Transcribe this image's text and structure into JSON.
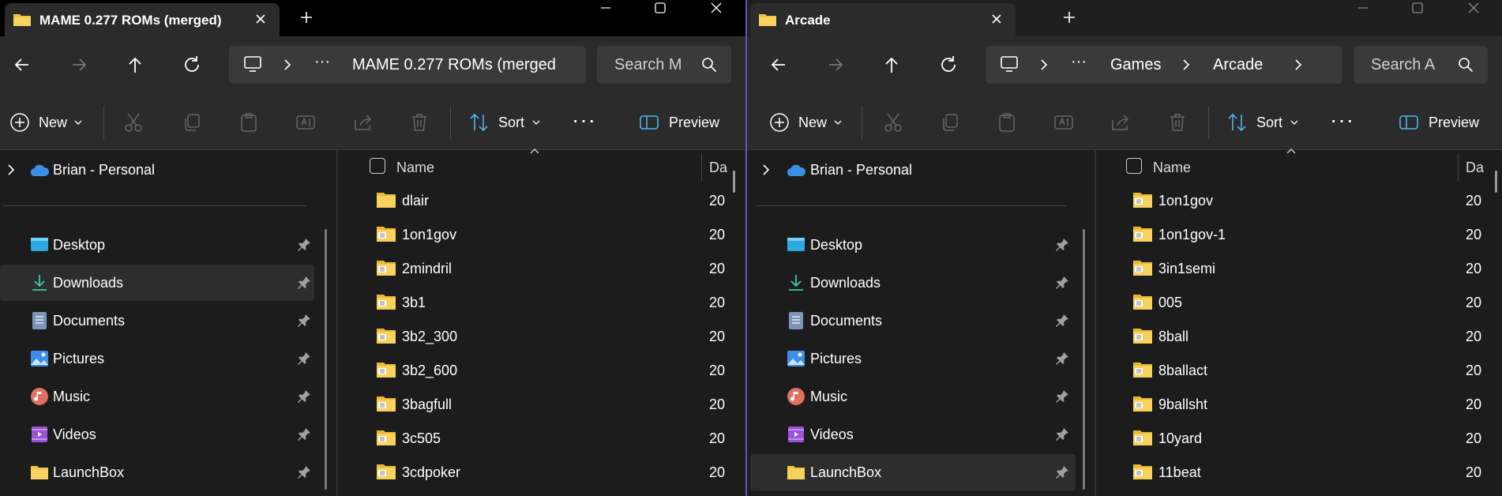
{
  "left": {
    "tab_title": "MAME 0.277 ROMs (merged)",
    "breadcrumb": [
      "MAME 0.277 ROMs (merged"
    ],
    "search_placeholder": "Search M",
    "toolbar": {
      "new": "New",
      "sort": "Sort",
      "preview": "Preview"
    },
    "nav": {
      "onedrive": "Brian - Personal",
      "items": [
        "Desktop",
        "Downloads",
        "Documents",
        "Pictures",
        "Music",
        "Videos",
        "LaunchBox"
      ],
      "selected": "Downloads"
    },
    "columns": {
      "name": "Name",
      "date": "Da"
    },
    "files": [
      {
        "name": "dlair",
        "date": "20"
      },
      {
        "name": "1on1gov",
        "date": "20"
      },
      {
        "name": "2mindril",
        "date": "20"
      },
      {
        "name": "3b1",
        "date": "20"
      },
      {
        "name": "3b2_300",
        "date": "20"
      },
      {
        "name": "3b2_600",
        "date": "20"
      },
      {
        "name": "3bagfull",
        "date": "20"
      },
      {
        "name": "3c505",
        "date": "20"
      },
      {
        "name": "3cdpoker",
        "date": "20"
      }
    ]
  },
  "right": {
    "tab_title": "Arcade",
    "breadcrumb": [
      "Games",
      "Arcade"
    ],
    "search_placeholder": "Search A",
    "toolbar": {
      "new": "New",
      "sort": "Sort",
      "preview": "Preview"
    },
    "nav": {
      "onedrive": "Brian - Personal",
      "items": [
        "Desktop",
        "Downloads",
        "Documents",
        "Pictures",
        "Music",
        "Videos",
        "LaunchBox"
      ],
      "selected": "LaunchBox"
    },
    "columns": {
      "name": "Name",
      "date": "Da"
    },
    "files": [
      {
        "name": "1on1gov",
        "date": "20"
      },
      {
        "name": "1on1gov-1",
        "date": "20"
      },
      {
        "name": "3in1semi",
        "date": "20"
      },
      {
        "name": "005",
        "date": "20"
      },
      {
        "name": "8ball",
        "date": "20"
      },
      {
        "name": "8ballact",
        "date": "20"
      },
      {
        "name": "9ballsht",
        "date": "20"
      },
      {
        "name": "10yard",
        "date": "20"
      },
      {
        "name": "11beat",
        "date": "20"
      }
    ]
  },
  "colors": {
    "accent_divider": "#6a4fc9",
    "folder": "#f4c542",
    "onedrive": "#3a8fe0"
  }
}
